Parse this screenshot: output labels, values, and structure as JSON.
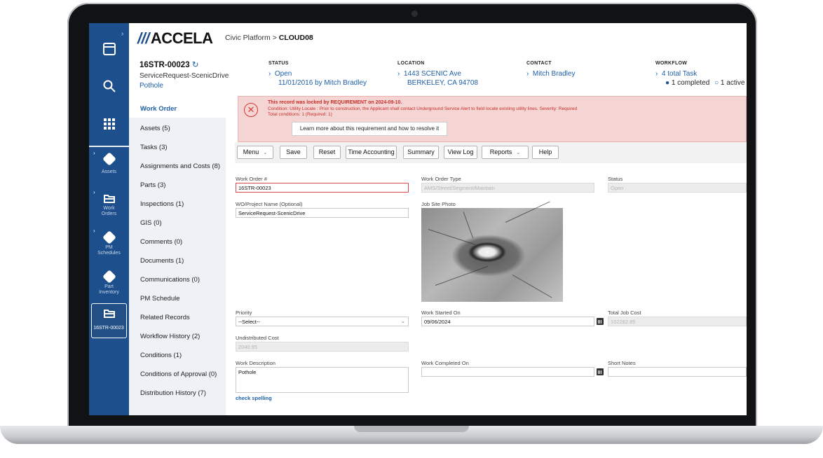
{
  "app": {
    "logo": "ACCELA",
    "breadcrumb_platform": "Civic Platform",
    "breadcrumb_sep": ">",
    "breadcrumb_agency": "CLOUD08"
  },
  "sidebar": {
    "items": [
      {
        "label": "Assets"
      },
      {
        "label": "Work Orders"
      },
      {
        "label": "PM Schedules"
      },
      {
        "label": "Part Inventory"
      },
      {
        "label": "16STR-00023"
      }
    ]
  },
  "record": {
    "id": "16STR-00023",
    "type": "ServiceRequest-ScenicDrive",
    "subtype": "Pothole",
    "status": {
      "header": "STATUS",
      "value": "Open",
      "detail": "11/01/2016 by Mitch Bradley"
    },
    "location": {
      "header": "LOCATION",
      "line1": "1443 SCENIC Ave",
      "line2": "BERKELEY, CA 94708"
    },
    "contact": {
      "header": "CONTACT",
      "value": "Mitch Bradley"
    },
    "workflow": {
      "header": "WORKFLOW",
      "value": "4 total Task",
      "completed": "1 completed",
      "active": "1 active"
    }
  },
  "menu": [
    "Work Order",
    "Assets (5)",
    "Tasks (3)",
    "Assignments and Costs (8)",
    "Parts (3)",
    "Inspections (1)",
    "GIS (0)",
    "Comments (0)",
    "Documents (1)",
    "Communications (0)",
    "PM Schedule",
    "Related Records",
    "Workflow History (2)",
    "Conditions (1)",
    "Conditions of Approval (0)",
    "Distribution History (7)"
  ],
  "alert": {
    "title": "This record was locked by REQUIREMENT on 2024-09-10.",
    "condition": "Condition: Utility Locate : Prior to construction, the Applicant shall contact Underground Service Alert to field locate existing utility lines. Severity: Required",
    "totals": "Total conditions: 1   (Required: 1)",
    "button": "Learn more about this requirement and how to resolve it"
  },
  "toolbar": {
    "menu": "Menu",
    "save": "Save",
    "reset": "Reset",
    "time_accounting": "Time Accounting",
    "summary": "Summary",
    "view_log": "View Log",
    "reports": "Reports",
    "help": "Help"
  },
  "form": {
    "work_order_label": "Work Order #",
    "work_order_value": "16STR-00023",
    "wo_type_label": "Work Order Type",
    "wo_type_value": "AMS/Street/Segment/Maintain",
    "status_label": "Status",
    "status_value": "Open",
    "project_label": "WO/Project Name (Optional)",
    "project_value": "ServiceRequest-ScenicDrive",
    "photo_label": "Job Site Photo",
    "priority_label": "Priority",
    "priority_value": "--Select--",
    "started_label": "Work Started On",
    "started_value": "09/06/2024",
    "total_cost_label": "Total Job Cost",
    "total_cost_value": "102282.85",
    "undistributed_label": "Undistributed Cost",
    "undistributed_value": "2040.95",
    "description_label": "Work Description",
    "description_value": "Pothole",
    "completed_label": "Work Completed On",
    "completed_value": "",
    "notes_label": "Short Notes",
    "notes_value": "",
    "spell_check": "check spelling"
  }
}
